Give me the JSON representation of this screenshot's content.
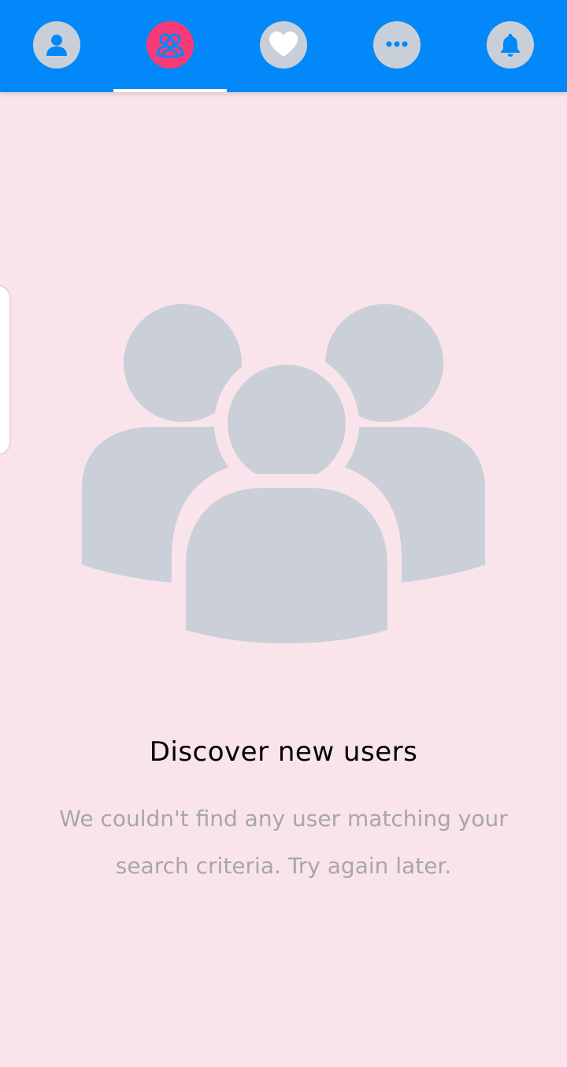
{
  "tabs": [
    {
      "name": "profile",
      "icon": "person-icon",
      "active": false
    },
    {
      "name": "discover",
      "icon": "users-icon",
      "active": true
    },
    {
      "name": "likes",
      "icon": "heart-icon",
      "active": false
    },
    {
      "name": "messages",
      "icon": "chat-bubble-icon",
      "active": false
    },
    {
      "name": "notifications",
      "icon": "bell-icon",
      "active": false
    }
  ],
  "colors": {
    "topbar": "#0288f8",
    "active_tab": "#f73a78",
    "inactive_tab": "#c9cfd8",
    "background": "#fae4ec",
    "illustration": "#cbcfd8"
  },
  "empty_state": {
    "icon": "users-group-icon",
    "title": "Discover new users",
    "message": "We couldn't find any user matching your search criteria. Try again later."
  }
}
